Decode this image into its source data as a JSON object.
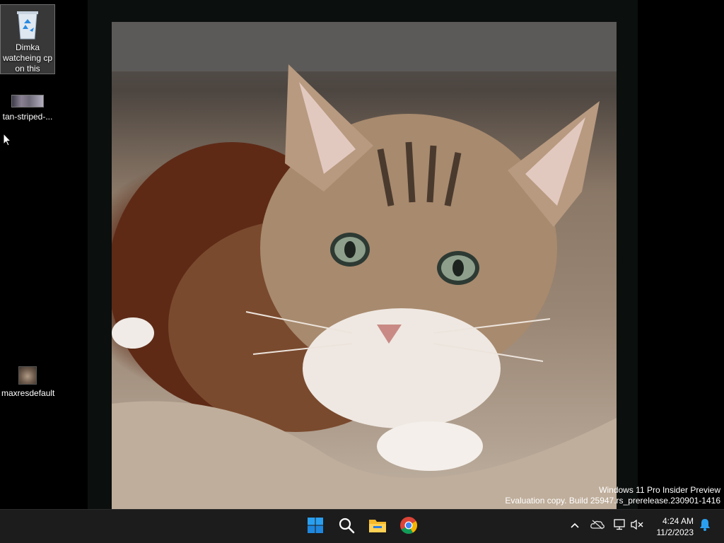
{
  "desktop": {
    "icons": [
      {
        "label": "Dimka watcheing cp on this",
        "icon": "recycle-bin-icon"
      },
      {
        "label": "tan-striped-...",
        "icon": "image-thumbnail-icon"
      },
      {
        "label": "maxresdefault",
        "icon": "image-thumbnail-icon"
      }
    ],
    "wallpaper": "tabby-cat-photo"
  },
  "watermark": {
    "line1": "Windows 11 Pro Insider Preview",
    "line2": "Evaluation copy. Build 25947.rs_prerelease.230901-1416"
  },
  "taskbar": {
    "pinned": [
      "windows-start-icon",
      "search-icon",
      "file-explorer-icon",
      "chrome-icon"
    ],
    "tray": [
      "chevron-up-icon",
      "onedrive-offline-icon",
      "network-icon",
      "volume-muted-icon"
    ],
    "clock": {
      "time": "4:24 AM",
      "date": "11/2/2023"
    },
    "notification_icon": "bell-icon"
  },
  "colors": {
    "taskbar_bg": "#1c1c1c",
    "accent_blue": "#2a7de1"
  }
}
